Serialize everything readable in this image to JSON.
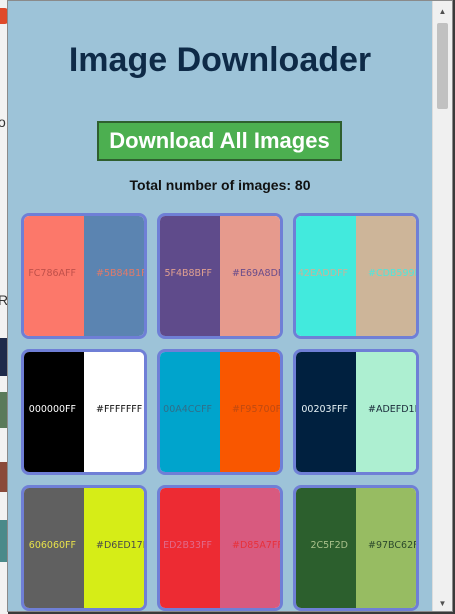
{
  "background": {
    "letter_o": "o",
    "letter_r": "R"
  },
  "popup": {
    "title": "Image Downloader",
    "download_button_label": "Download All Images",
    "count_label": "Total number of images: 80",
    "images": [
      {
        "left": {
          "color": "#FC786A",
          "label": "FC786AFF",
          "text_color": "#c0504a"
        },
        "right": {
          "color": "#5B84B1",
          "label": "#5B84B1F",
          "text_color": "#e07a6a"
        }
      },
      {
        "left": {
          "color": "#5F4B8B",
          "label": "5F4B8BFF",
          "text_color": "#e0a090"
        },
        "right": {
          "color": "#E69A8D",
          "label": "#E69A8DF",
          "text_color": "#6a4c8a"
        }
      },
      {
        "left": {
          "color": "#42EADD",
          "label": "42EADDFF",
          "text_color": "#c7b49a"
        },
        "right": {
          "color": "#CDB599",
          "label": "#CDB599F",
          "text_color": "#4ee6dc"
        }
      },
      {
        "left": {
          "color": "#000000",
          "label": "000000FF",
          "text_color": "#ffffff"
        },
        "right": {
          "color": "#FFFFFF",
          "label": "#FFFFFFF",
          "text_color": "#111111"
        }
      },
      {
        "left": {
          "color": "#00A4CC",
          "label": "00A4CCFF",
          "text_color": "#2f6f8a"
        },
        "right": {
          "color": "#F95700",
          "label": "#F95700F",
          "text_color": "#c04a10"
        }
      },
      {
        "left": {
          "color": "#00203F",
          "label": "00203FFF",
          "text_color": "#e8f4f8"
        },
        "right": {
          "color": "#ADEFD1",
          "label": "#ADEFD1F",
          "text_color": "#1a2a3a"
        }
      },
      {
        "left": {
          "color": "#606060",
          "label": "606060FF",
          "text_color": "#e6e04a"
        },
        "right": {
          "color": "#D6ED17",
          "label": "#D6ED17F",
          "text_color": "#4a4a4a"
        }
      },
      {
        "left": {
          "color": "#ED2B33",
          "label": "ED2B33FF",
          "text_color": "#e06a8a"
        },
        "right": {
          "color": "#D85A7F",
          "label": "#D85A7FF",
          "text_color": "#e8303a"
        }
      },
      {
        "left": {
          "color": "#2C5F2D",
          "label": "2C5F2D",
          "text_color": "#a8c08a"
        },
        "right": {
          "color": "#97BC62",
          "label": "#97BC62F",
          "text_color": "#2c4a2c"
        }
      }
    ]
  },
  "scrollbar": {
    "up_icon": "triangle-up",
    "down_icon": "triangle-down"
  }
}
